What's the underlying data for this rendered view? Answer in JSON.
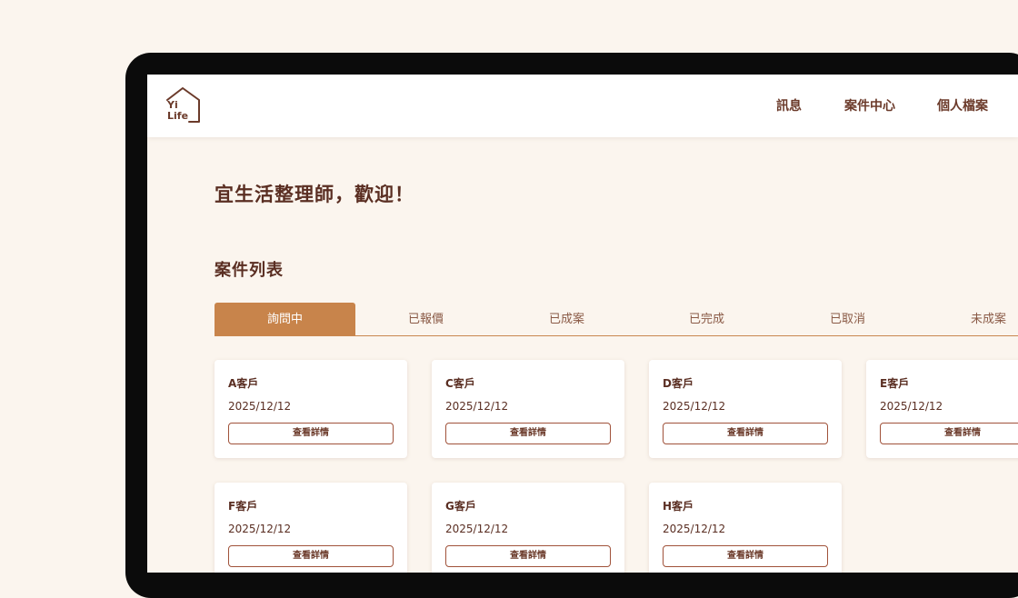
{
  "logo": {
    "line1": "Yi",
    "line2": "Life"
  },
  "nav": {
    "messages": "訊息",
    "cases": "案件中心",
    "profile": "個人檔案"
  },
  "welcome": "宜生活整理師，歡迎！",
  "section_title": "案件列表",
  "tabs": [
    "詢問中",
    "已報價",
    "已成案",
    "已完成",
    "已取消",
    "未成案"
  ],
  "active_tab": "詢問中",
  "cards": [
    {
      "name": "A客戶",
      "date": "2025/12/12",
      "button": "查看詳情"
    },
    {
      "name": "C客戶",
      "date": "2025/12/12",
      "button": "查看詳情"
    },
    {
      "name": "D客戶",
      "date": "2025/12/12",
      "button": "查看詳情"
    },
    {
      "name": "E客戶",
      "date": "2025/12/12",
      "button": "查看詳情"
    },
    {
      "name": "F客戶",
      "date": "2025/12/12",
      "button": "查看詳情"
    },
    {
      "name": "G客戶",
      "date": "2025/12/12",
      "button": "查看詳情"
    },
    {
      "name": "H客戶",
      "date": "2025/12/12",
      "button": "查看詳情"
    }
  ],
  "colors": {
    "page_bg": "#fbf5ee",
    "brand": "#c8844b",
    "text": "#5a2e22",
    "button_border": "#a0523a"
  },
  "icons": {
    "logo": "house-outline-icon"
  }
}
